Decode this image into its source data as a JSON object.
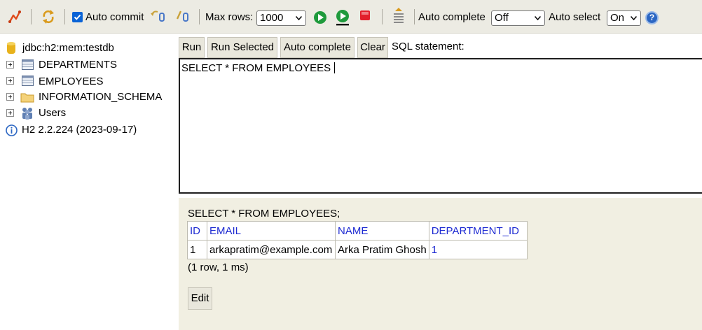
{
  "toolbar": {
    "auto_commit_label": "Auto commit",
    "auto_commit_checked": true,
    "max_rows_label": "Max rows:",
    "max_rows_value": "1000",
    "auto_complete_label": "Auto complete",
    "auto_complete_value": "Off",
    "auto_select_label": "Auto select",
    "auto_select_value": "On",
    "help_glyph": "?",
    "icons": [
      "disconnect-icon",
      "refresh-icon",
      "rollback-icon",
      "commit-icon",
      "run-icon",
      "run-selected-icon",
      "stop-icon",
      "history-icon",
      "help-icon"
    ],
    "accent_color": "#0a63d6"
  },
  "tree": {
    "connection": "jdbc:h2:mem:testdb",
    "items": [
      {
        "label": "DEPARTMENTS",
        "icon": "table-icon"
      },
      {
        "label": "EMPLOYEES",
        "icon": "table-icon"
      },
      {
        "label": "INFORMATION_SCHEMA",
        "icon": "folder-icon"
      },
      {
        "label": "Users",
        "icon": "users-icon"
      }
    ],
    "version": "H2 2.2.224 (2023-09-17)"
  },
  "query_panel": {
    "run_label": "Run",
    "run_selected_label": "Run Selected",
    "auto_complete_label": "Auto complete",
    "clear_label": "Clear",
    "sql_statement_label": "SQL statement:",
    "sql_text": "SELECT * FROM EMPLOYEES"
  },
  "results": {
    "query": "SELECT * FROM EMPLOYEES;",
    "columns": [
      "ID",
      "EMAIL",
      "NAME",
      "DEPARTMENT_ID"
    ],
    "rows": [
      [
        "1",
        "arkapratim@example.com",
        "Arka Pratim Ghosh",
        "1"
      ]
    ],
    "row_count": "(1 row, 1 ms)",
    "edit_label": "Edit",
    "header_color": "#1e2bd2"
  }
}
